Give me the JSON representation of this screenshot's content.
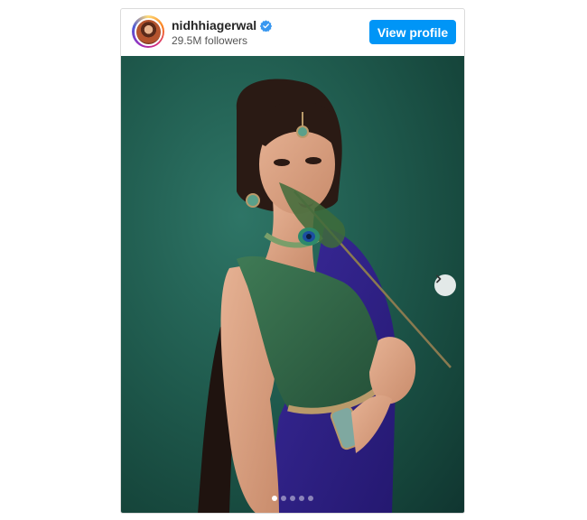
{
  "header": {
    "username": "nidhhiagerwal",
    "verified": true,
    "followers": "29.5M followers",
    "view_profile_label": "View profile"
  },
  "media": {
    "type": "photo carousel",
    "slide_count": 5,
    "active_slide": 1
  },
  "colors": {
    "button": "#0095f6",
    "verified_badge": "#3897f0",
    "background_green": "#1f5a4d"
  },
  "icons": {
    "verified": "verified-badge-icon",
    "next": "chevron-right-icon"
  }
}
